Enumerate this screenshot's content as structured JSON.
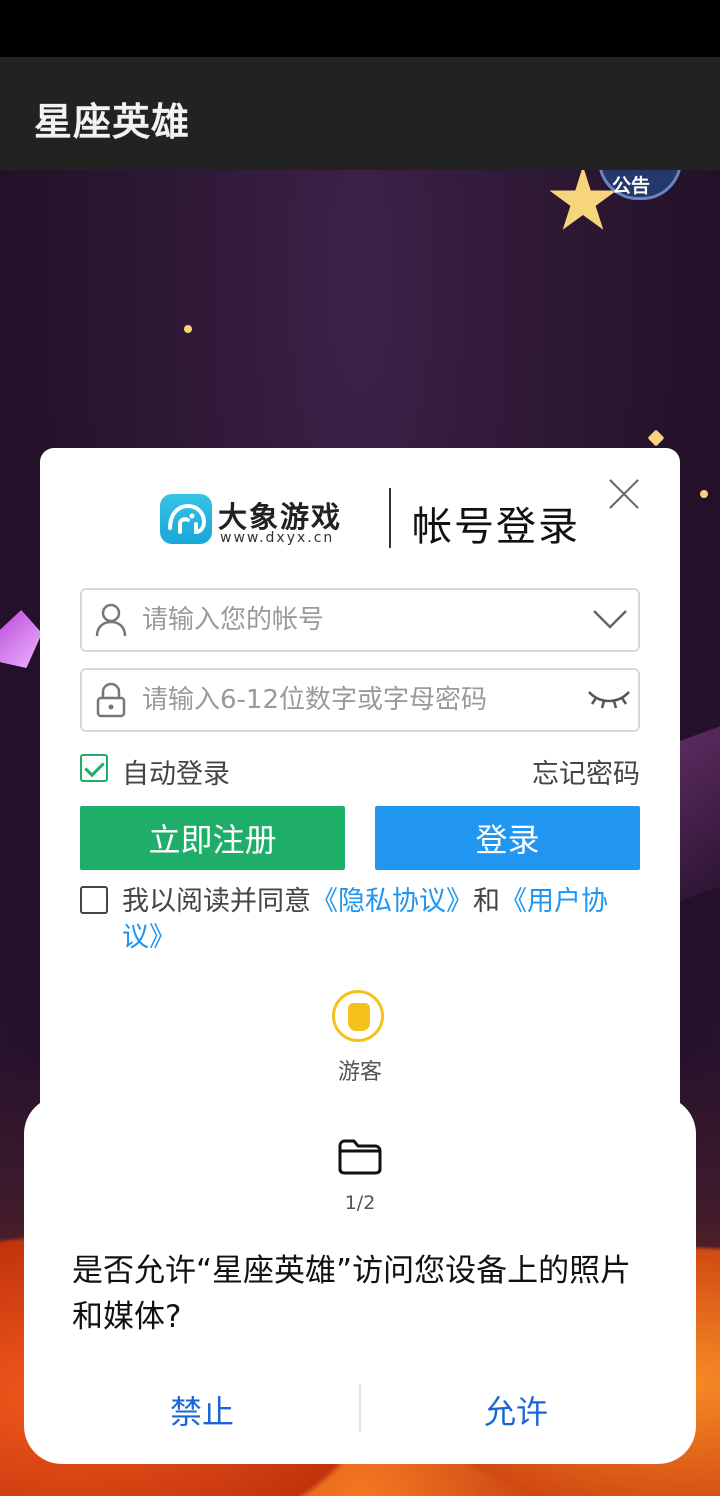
{
  "app_bar": {
    "title": "星座英雄"
  },
  "game": {
    "notice_label": "公告"
  },
  "login": {
    "brand_name": "大象游戏",
    "brand_url": "www.dxyx.cn",
    "title": "帐号登录",
    "account_placeholder": "请输入您的帐号",
    "password_placeholder": "请输入6-12位数字或字母密码",
    "auto_login_label": "自动登录",
    "auto_login_checked": true,
    "forgot_label": "忘记密码",
    "register_label": "立即注册",
    "login_label": "登录",
    "agree_prefix": "我以阅读并同意",
    "privacy_link": "《隐私协议》",
    "agree_and": "和",
    "user_agreement_link": "《用户协议》",
    "guest_label": "游客"
  },
  "permission": {
    "page_indicator": "1/2",
    "message": "是否允许“星座英雄”访问您设备上的照片和媒体?",
    "deny_label": "禁止",
    "allow_label": "允许"
  },
  "colors": {
    "register_green": "#1fae6a",
    "login_blue": "#2196f0",
    "link_blue": "#2196f0",
    "dialog_button_blue": "#1a66d9"
  }
}
